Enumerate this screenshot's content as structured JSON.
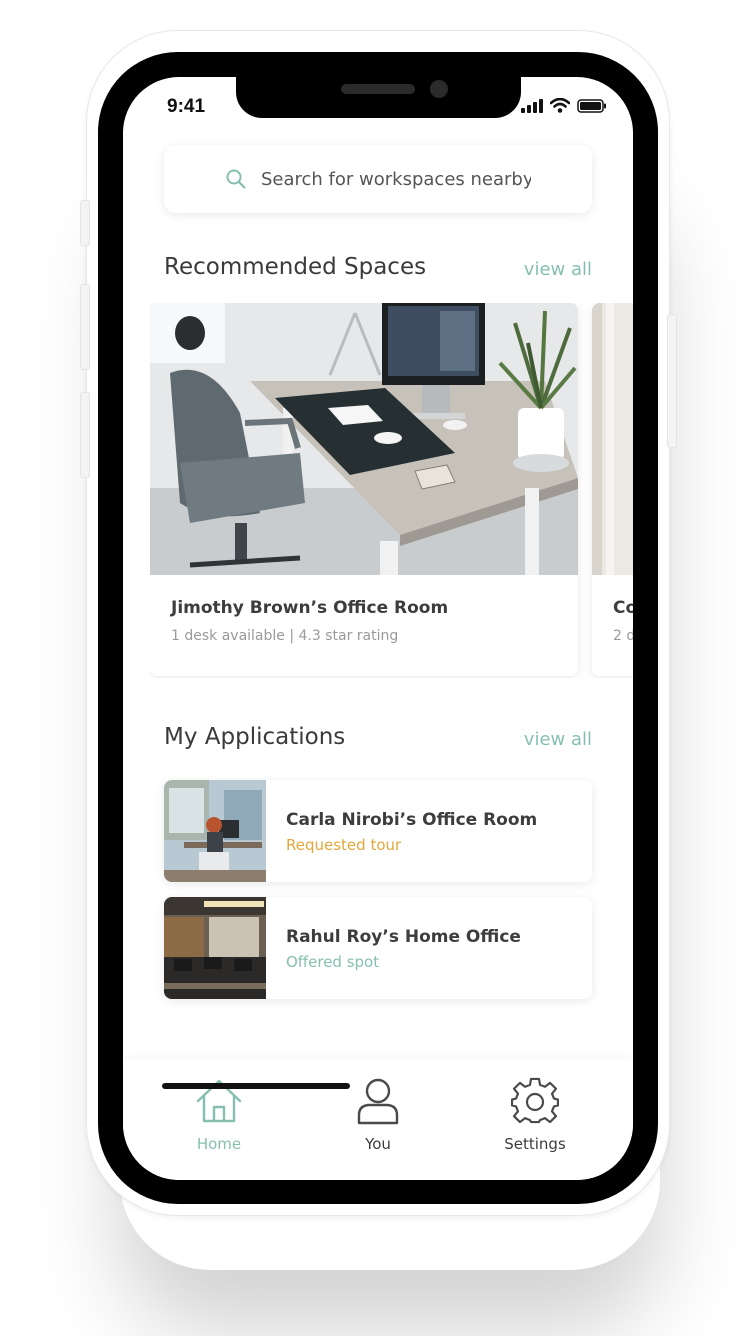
{
  "status_bar": {
    "time": "9:41"
  },
  "search": {
    "placeholder": "Search for workspaces nearby"
  },
  "recommended": {
    "title": "Recommended Spaces",
    "view_all": "view all",
    "cards": [
      {
        "title": "Jimothy Brown’s Office Room",
        "subtitle": "1 desk available | 4.3 star rating"
      },
      {
        "title": "Co",
        "subtitle": "2 d"
      }
    ]
  },
  "applications": {
    "title": "My Applications",
    "view_all": "view all",
    "items": [
      {
        "title": "Carla Nirobi’s Office Room",
        "status": "Requested tour",
        "status_color": "#e3a73c"
      },
      {
        "title": "Rahul Roy’s Home Office",
        "status": "Offered spot",
        "status_color": "#86bfb0"
      }
    ]
  },
  "tabbar": {
    "tabs": [
      {
        "label": "Home",
        "icon": "home-icon",
        "active": true
      },
      {
        "label": "You",
        "icon": "user-icon",
        "active": false
      },
      {
        "label": "Settings",
        "icon": "gear-icon",
        "active": false
      }
    ]
  },
  "colors": {
    "accent": "#86bfb0",
    "text_primary": "#3d3d3d",
    "text_secondary": "#9a9a9a",
    "pending": "#e3a73c"
  }
}
